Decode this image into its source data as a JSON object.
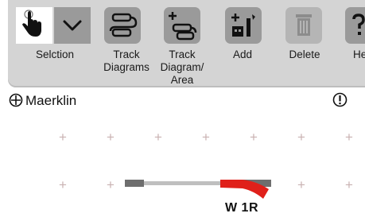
{
  "toolbar": {
    "selection_label": "Selction",
    "track_diagrams_label": "Track\nDiagrams",
    "track_diagram_area_label": "Track\nDiagram/\nArea",
    "add_label": "Add",
    "delete_label": "Delete",
    "help_label": "He"
  },
  "layout": {
    "title": "Maerklin",
    "track_label": "W 1R"
  },
  "colors": {
    "toolbar_bg": "#d4d4d4",
    "button_bg": "#9a9a9a",
    "track_gray": "#bfbfbf",
    "track_dark": "#6e6e6e",
    "track_red": "#e0201a",
    "grid_plus": "#c9b2b2"
  },
  "icons": [
    "hand-pointer-icon",
    "chevron-down-icon",
    "track-diagrams-icon",
    "track-diagram-area-icon",
    "add-icon",
    "delete-icon",
    "help-icon",
    "move-icon",
    "info-icon"
  ]
}
